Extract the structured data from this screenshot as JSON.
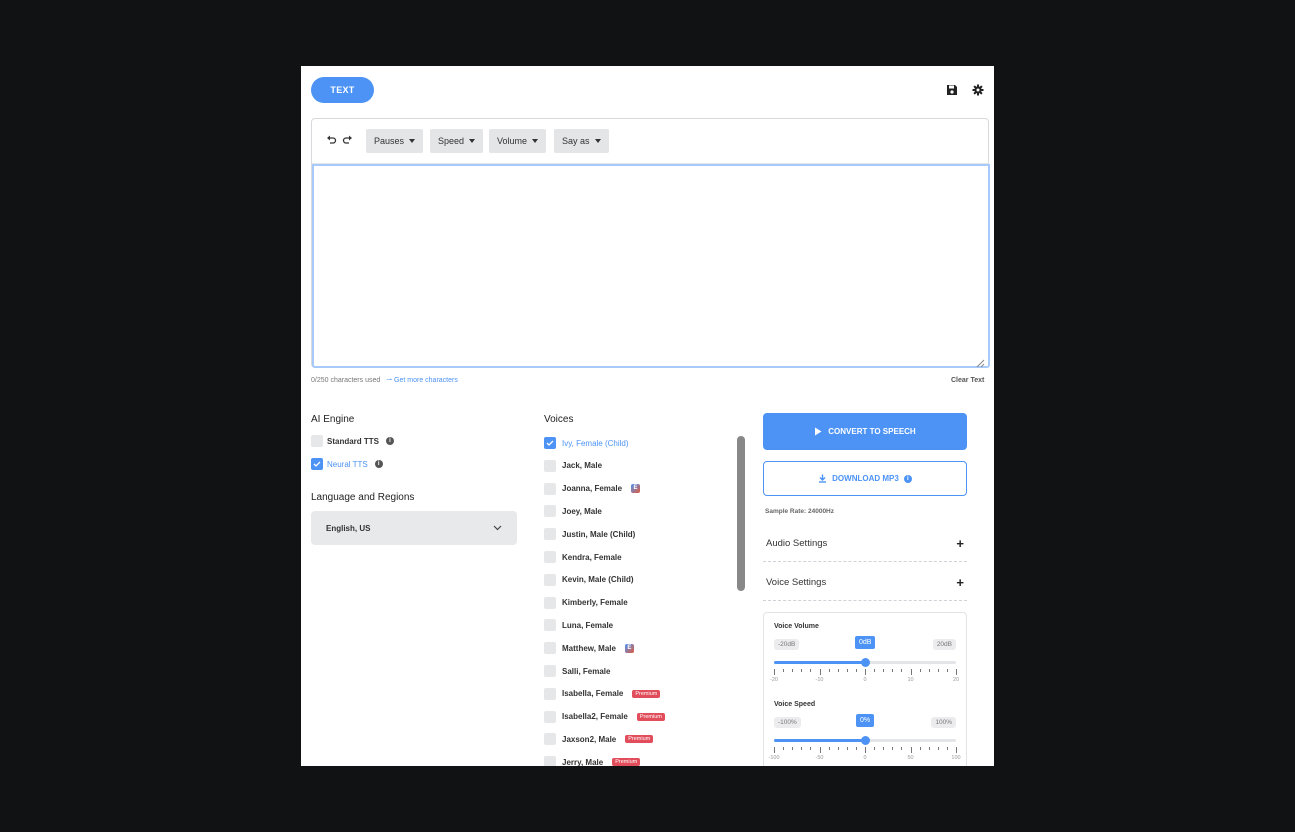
{
  "header": {
    "tab_text": "TEXT",
    "save_icon": "save-icon",
    "settings_icon": "gear-icon"
  },
  "toolbar": {
    "undo_icon": "undo-icon",
    "redo_icon": "redo-icon",
    "buttons": [
      {
        "label": "Pauses"
      },
      {
        "label": "Speed"
      },
      {
        "label": "Volume"
      },
      {
        "label": "Say as"
      }
    ]
  },
  "editor": {
    "value": "",
    "chars_used": "0/250 characters used",
    "get_more": "Get more characters",
    "clear": "Clear Text"
  },
  "engine": {
    "title": "AI Engine",
    "options": [
      {
        "label": "Standard TTS",
        "checked": false
      },
      {
        "label": "Neural TTS",
        "checked": true
      }
    ]
  },
  "language": {
    "title": "Language and Regions",
    "selected": "English, US"
  },
  "voices": {
    "title": "Voices",
    "items": [
      {
        "name": "Ivy, Female (Child)",
        "checked": true,
        "badge": ""
      },
      {
        "name": "Jack, Male",
        "checked": false,
        "badge": ""
      },
      {
        "name": "Joanna, Female",
        "checked": false,
        "badge": "E"
      },
      {
        "name": "Joey, Male",
        "checked": false,
        "badge": ""
      },
      {
        "name": "Justin, Male (Child)",
        "checked": false,
        "badge": ""
      },
      {
        "name": "Kendra, Female",
        "checked": false,
        "badge": ""
      },
      {
        "name": "Kevin, Male (Child)",
        "checked": false,
        "badge": ""
      },
      {
        "name": "Kimberly, Female",
        "checked": false,
        "badge": ""
      },
      {
        "name": "Luna, Female",
        "checked": false,
        "badge": ""
      },
      {
        "name": "Matthew, Male",
        "checked": false,
        "badge": "E"
      },
      {
        "name": "Salli, Female",
        "checked": false,
        "badge": ""
      },
      {
        "name": "Isabella, Female",
        "checked": false,
        "badge": "Premium"
      },
      {
        "name": "Isabella2, Female",
        "checked": false,
        "badge": "Premium"
      },
      {
        "name": "Jaxson2, Male",
        "checked": false,
        "badge": "Premium"
      },
      {
        "name": "Jerry, Male",
        "checked": false,
        "badge": "Premium"
      }
    ]
  },
  "actions": {
    "convert": "CONVERT TO SPEECH",
    "download": "DOWNLOAD MP3",
    "sample_rate": "Sample Rate: 24000Hz"
  },
  "accordions": [
    {
      "label": "Audio Settings"
    },
    {
      "label": "Voice Settings"
    }
  ],
  "voice_settings": {
    "volume": {
      "title": "Voice Volume",
      "min_label": "-20dB",
      "max_label": "20dB",
      "value_label": "0dB",
      "min": -20,
      "max": 20,
      "value": 0,
      "tick_labels": [
        "-20",
        "-10",
        "0",
        "10",
        "20"
      ]
    },
    "speed": {
      "title": "Voice Speed",
      "min_label": "-100%",
      "max_label": "100%",
      "value_label": "0%",
      "min": -100,
      "max": 100,
      "value": 0,
      "tick_labels": [
        "-100",
        "-50",
        "0",
        "50",
        "100"
      ]
    }
  },
  "colors": {
    "accent": "#4c93f5",
    "premium": "#e14d5a",
    "background": "#111213"
  }
}
